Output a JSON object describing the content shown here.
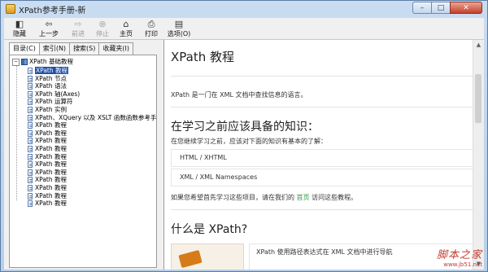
{
  "window": {
    "title": "XPath参考手册-新",
    "buttons": {
      "minimize": "–",
      "maximize": "□",
      "close": "✕"
    }
  },
  "toolbar": {
    "items": [
      {
        "label": "隐藏",
        "icon": "hide-icon",
        "glyph": "◧",
        "enabled": true
      },
      {
        "label": "上一步",
        "icon": "back-arrow-icon",
        "glyph": "⇦",
        "enabled": true
      },
      {
        "label": "前进",
        "icon": "forward-arrow-icon",
        "glyph": "⇨",
        "enabled": false
      },
      {
        "label": "停止",
        "icon": "stop-icon",
        "glyph": "⊗",
        "enabled": false
      },
      {
        "label": "主页",
        "icon": "home-icon",
        "glyph": "⌂",
        "enabled": true
      },
      {
        "label": "打印",
        "icon": "print-icon",
        "glyph": "⎙",
        "enabled": true
      },
      {
        "label": "选项(O)",
        "icon": "options-icon",
        "glyph": "▤",
        "enabled": true
      }
    ]
  },
  "tabs": [
    "目录(C)",
    "索引(N)",
    "搜索(S)",
    "收藏夹(I)"
  ],
  "tree": {
    "root": "XPath 基础教程",
    "items": [
      "XPath 教程",
      "XPath 节点",
      "XPath 语法",
      "XPath 轴(Axes)",
      "XPath 运算符",
      "XPath 实例",
      "XPath、XQuery 以及 XSLT 函数函数参考手册",
      "XPath 教程",
      "XPath 教程",
      "XPath 教程",
      "XPath 教程",
      "XPath 教程",
      "XPath 教程",
      "XPath 教程",
      "XPath 教程",
      "XPath 教程",
      "XPath 教程",
      "XPath 教程"
    ],
    "selected_index": 0
  },
  "content": {
    "title": "XPath 教程",
    "intro": "XPath 是一门在 XML 文档中查找信息的语言。",
    "prereq_heading": "在学习之前应该具备的知识：",
    "prereq_text": "在您继续学习之前，应该对下面的知识有基本的了解：",
    "prereq_items": [
      "HTML / XHTML",
      "XML / XML Namespaces"
    ],
    "prereq_note_before": "如果您希望首先学习这些项目，请在我们的",
    "prereq_note_link": "首页",
    "prereq_note_after": "访问这些教程。",
    "what_heading": "什么是 XPath?",
    "what_text": "XPath 使用路径表达式在 XML 文档中进行导航"
  },
  "watermark": {
    "line1": "脚本之家",
    "line2": "www.jb51.net"
  },
  "colors": {
    "selection": "#1f4fa8",
    "link": "#2e9b4a",
    "title_gradient_top": "#c9dcf1"
  }
}
